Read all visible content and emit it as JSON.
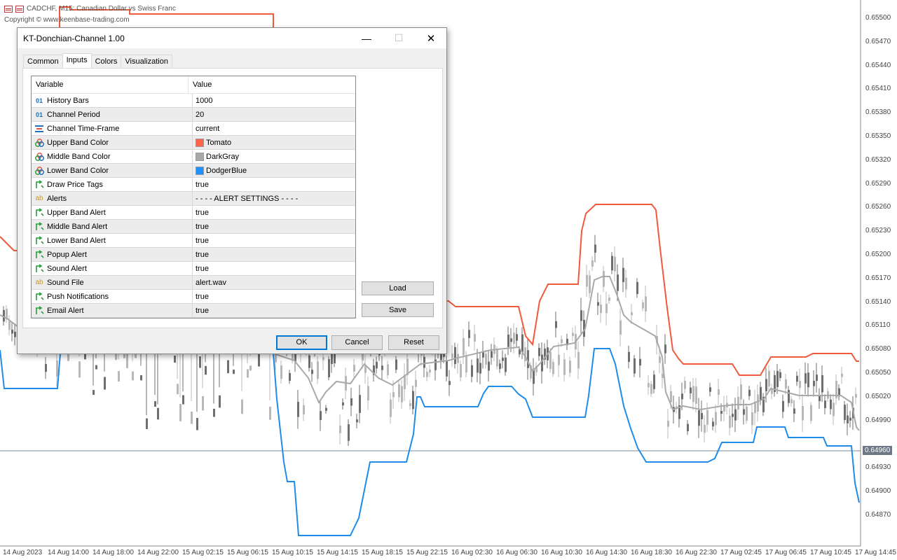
{
  "chart": {
    "title": "CADCHF, M15:  Canadian Dollar vs Swiss Franc",
    "copyright": "Copyright © www.keenbase-trading.com",
    "current_price": "0.64960",
    "price_levels": [
      "0.65500",
      "0.65470",
      "0.65440",
      "0.65410",
      "0.65380",
      "0.65350",
      "0.65320",
      "0.65290",
      "0.65260",
      "0.65230",
      "0.65200",
      "0.65170",
      "0.65140",
      "0.65110",
      "0.65080",
      "0.65050",
      "0.65020",
      "0.64990",
      "0.64930",
      "0.64900",
      "0.64870"
    ],
    "time_labels": [
      "14 Aug 2023",
      "14 Aug 14:00",
      "14 Aug 18:00",
      "14 Aug 22:00",
      "15 Aug 02:15",
      "15 Aug 06:15",
      "15 Aug 10:15",
      "15 Aug 14:15",
      "15 Aug 18:15",
      "15 Aug 22:15",
      "16 Aug 02:30",
      "16 Aug 06:30",
      "16 Aug 10:30",
      "16 Aug 14:30",
      "16 Aug 18:30",
      "16 Aug 22:30",
      "17 Aug 02:45",
      "17 Aug 06:45",
      "17 Aug 10:45",
      "17 Aug 14:45"
    ],
    "colors": {
      "upper": "#f05a3a",
      "middle": "#a9a9a9",
      "lower": "#1e8ce8",
      "candle_up": "#b8b8b8",
      "candle_down": "#6e6e6e"
    }
  },
  "dialog": {
    "title": "KT-Donchian-Channel 1.00",
    "minimize": "—",
    "maximize": "☐",
    "close": "✕",
    "tabs": [
      {
        "label": "Common"
      },
      {
        "label": "Inputs"
      },
      {
        "label": "Colors"
      },
      {
        "label": "Visualization"
      }
    ],
    "grid": {
      "col_variable": "Variable",
      "col_value": "Value",
      "rows": [
        {
          "icon": "int",
          "name": "History Bars",
          "value": "1000"
        },
        {
          "icon": "int",
          "name": "Channel Period",
          "value": "20"
        },
        {
          "icon": "enum",
          "name": "Channel Time-Frame",
          "value": "current"
        },
        {
          "icon": "color",
          "name": "Upper Band Color",
          "value": "Tomato",
          "swatch": "#ff6347"
        },
        {
          "icon": "color",
          "name": "Middle Band Color",
          "value": "DarkGray",
          "swatch": "#a9a9a9"
        },
        {
          "icon": "color",
          "name": "Lower Band Color",
          "value": "DodgerBlue",
          "swatch": "#1e90ff"
        },
        {
          "icon": "bool",
          "name": "Draw Price Tags",
          "value": "true"
        },
        {
          "icon": "string",
          "name": "Alerts",
          "value": "- - - - ALERT SETTINGS - - - -"
        },
        {
          "icon": "bool",
          "name": "Upper Band Alert",
          "value": "true"
        },
        {
          "icon": "bool",
          "name": "Middle Band Alert",
          "value": "true"
        },
        {
          "icon": "bool",
          "name": "Lower Band Alert",
          "value": "true"
        },
        {
          "icon": "bool",
          "name": "Popup Alert",
          "value": "true"
        },
        {
          "icon": "bool",
          "name": "Sound Alert",
          "value": "true"
        },
        {
          "icon": "string",
          "name": "Sound File",
          "value": "alert.wav"
        },
        {
          "icon": "bool",
          "name": "Push Notifications",
          "value": "true"
        },
        {
          "icon": "bool",
          "name": "Email Alert",
          "value": "true"
        }
      ]
    },
    "load_label": "Load",
    "save_label": "Save",
    "ok_label": "OK",
    "cancel_label": "Cancel",
    "reset_label": "Reset"
  }
}
